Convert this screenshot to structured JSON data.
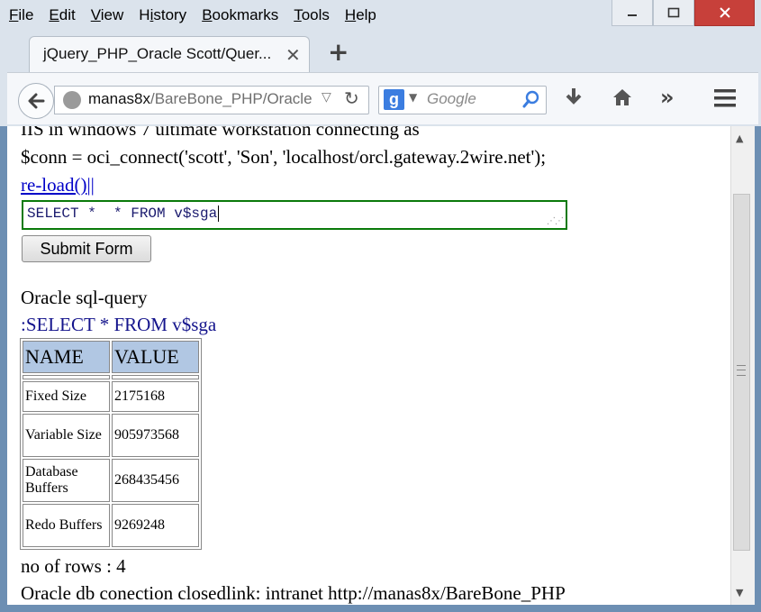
{
  "window": {
    "menu": [
      "File",
      "Edit",
      "View",
      "History",
      "Bookmarks",
      "Tools",
      "Help"
    ],
    "menu_underline": [
      "F",
      "E",
      "V",
      "i",
      "B",
      "T",
      "H"
    ],
    "tab_title": "jQuery_PHP_Oracle Scott/Quer...",
    "url_host": "manas8x",
    "url_path": "/BareBone_PHP/Oracle",
    "search_placeholder": "Google",
    "search_engine_letter": "g"
  },
  "icons": {
    "back": "back-arrow-icon",
    "site": "globe-icon",
    "reload": "reload-icon",
    "search": "magnifier-icon",
    "download": "download-icon",
    "home": "home-icon",
    "overflow": "chevron-double-right-icon",
    "menu": "hamburger-menu-icon",
    "close": "close-icon",
    "newtab": "plus-icon"
  },
  "page": {
    "line1": "IIS in windows 7 ultimate workstation connecting as",
    "line2": "$conn = oci_connect('scott', 'Son', 'localhost/orcl.gateway.2wire.net');",
    "reload_link": "re-load()",
    "reload_sep": "||",
    "query_value": "SELECT *  * FROM v$sga",
    "submit_label": "Submit Form",
    "heading": "Oracle sql-query",
    "query_echo": ":SELECT * FROM v$sga",
    "table": {
      "headers": [
        "NAME",
        "VALUE"
      ],
      "rows": [
        [
          "Fixed Size",
          "2175168"
        ],
        [
          "Variable Size",
          "905973568"
        ],
        [
          "Database Buffers",
          "268435456"
        ],
        [
          "Redo Buffers",
          "9269248"
        ]
      ]
    },
    "row_count": "no of rows : 4",
    "footer": "Oracle db conection closedlink: intranet http://manas8x/BareBone_PHP"
  },
  "colors": {
    "header_bg": "#b1c7e3",
    "textarea_border": "#0a7a0a",
    "link": "#0000c8",
    "close_btn": "#c7403a"
  }
}
